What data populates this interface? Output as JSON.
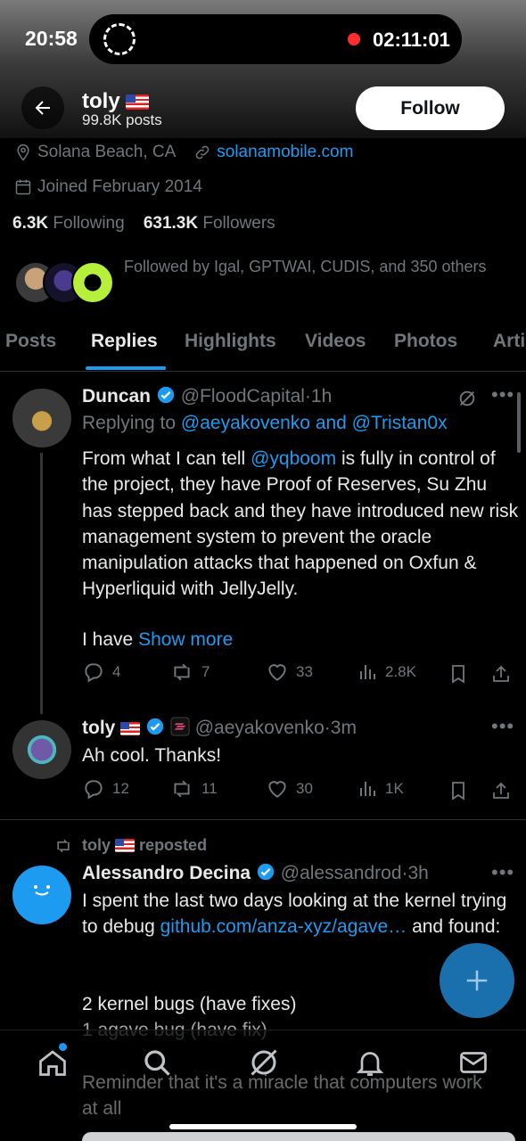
{
  "status_bar": {
    "time": "20:58",
    "recording_timer": "02:11:01"
  },
  "header": {
    "name": "toly",
    "posts": "99.8K posts",
    "follow_label": "Follow"
  },
  "profile": {
    "location": "Solana Beach, CA",
    "website": "solanamobile.com",
    "joined": "Joined February 2014",
    "following_count": "6.3K",
    "following_label": "Following",
    "followers_count": "631.3K",
    "followers_label": "Followers",
    "followed_by": "Followed by Igal, GPTWAI, CUDIS, and 350 others"
  },
  "tabs": [
    "Posts",
    "Replies",
    "Highlights",
    "Videos",
    "Photos",
    "Arti"
  ],
  "active_tab": "Replies",
  "tweets": [
    {
      "name": "Duncan",
      "handle": "@FloodCapital",
      "time": "1h",
      "replying_prefix": "Replying to",
      "replying_to": "@aeyakovenko and @Tristan0x",
      "body_pre": "From what I can tell",
      "body_mention": "@yqboom",
      "body_post": "is fully in control of the project, they have Proof of Reserves, Su Zhu has stepped back and they have introduced new risk management system to prevent the oracle manipulation attacks that happened on Oxfun & Hyperliquid with JellyJelly.",
      "body_tail": "I have",
      "show_more": "Show more",
      "replies": "4",
      "reposts": "7",
      "likes": "33",
      "views": "2.8K"
    },
    {
      "name": "toly",
      "handle": "@aeyakovenko",
      "time": "3m",
      "body": "Ah cool. Thanks!",
      "replies": "12",
      "reposts": "11",
      "likes": "30",
      "views": "1K"
    },
    {
      "repost_by": "toly",
      "repost_label": "reposted",
      "name": "Alessandro Decina",
      "handle": "@alessandrod",
      "time": "3h",
      "body_pre": "I spent the last two days looking at the kernel trying to debug",
      "body_link": "github.com/anza-xyz/agave…",
      "body_post": "and found:",
      "line1": "2 kernel bugs (have fixes)",
      "line2": "1 agave bug (have fix)",
      "line3": "Reminder that it's a miracle that computers work at all"
    }
  ],
  "colors": {
    "accent": "#1d9bf0",
    "background": "#000000",
    "muted": "#71767b"
  },
  "nav_icons": [
    "home-icon",
    "search-icon",
    "grok-icon",
    "notifications-icon",
    "messages-icon"
  ]
}
